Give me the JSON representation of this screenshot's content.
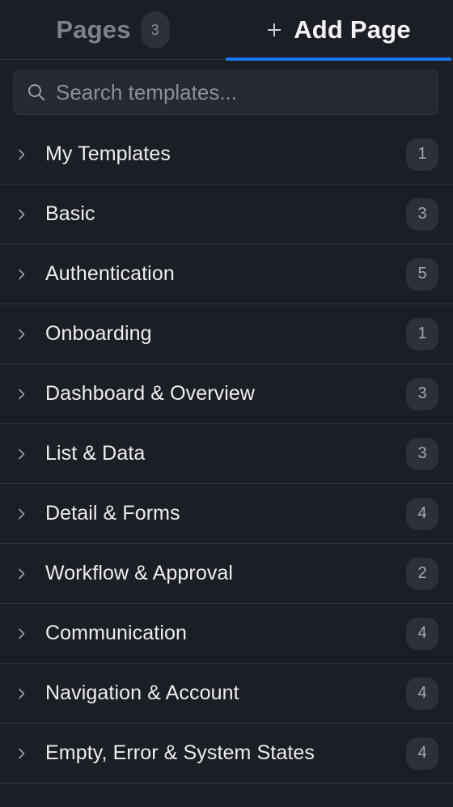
{
  "tabs": {
    "pages_label": "Pages",
    "pages_count": "3",
    "add_page_label": "Add Page",
    "active": "add_page"
  },
  "search": {
    "placeholder": "Search templates...",
    "value": ""
  },
  "categories": [
    {
      "label": "My Templates",
      "count": "1"
    },
    {
      "label": "Basic",
      "count": "3"
    },
    {
      "label": "Authentication",
      "count": "5"
    },
    {
      "label": "Onboarding",
      "count": "1"
    },
    {
      "label": "Dashboard & Overview",
      "count": "3"
    },
    {
      "label": "List & Data",
      "count": "3"
    },
    {
      "label": "Detail & Forms",
      "count": "4"
    },
    {
      "label": "Workflow & Approval",
      "count": "2"
    },
    {
      "label": "Communication",
      "count": "4"
    },
    {
      "label": "Navigation & Account",
      "count": "4"
    },
    {
      "label": "Empty, Error & System States",
      "count": "4"
    }
  ],
  "colors": {
    "background": "#1b1e25",
    "accent": "#1677ee",
    "badge_bg": "#2c3039",
    "divider": "#30343d"
  },
  "icons": {
    "search": "search-icon",
    "add": "plus-icon",
    "expand": "chevron-right-icon"
  }
}
